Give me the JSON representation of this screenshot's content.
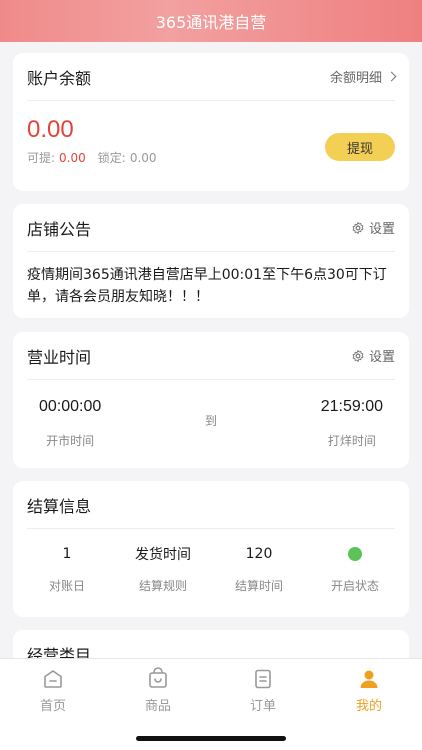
{
  "header": {
    "title": "365通讯港自营"
  },
  "balance": {
    "title": "账户余额",
    "detail_link": "余额明细",
    "amount": "0.00",
    "withdrawable_label": "可提:",
    "withdrawable_value": "0.00",
    "locked_label": "锁定:",
    "locked_value": "0.00",
    "withdraw_button": "提现"
  },
  "notice": {
    "title": "店铺公告",
    "settings_label": "设置",
    "text": "疫情期间365通讯港自营店早上00:01至下午6点30可下订单，请各会员朋友知晓！！！"
  },
  "hours": {
    "title": "营业时间",
    "settings_label": "设置",
    "open_time": "00:00:00",
    "open_label": "开市时间",
    "to_label": "到",
    "close_time": "21:59:00",
    "close_label": "打烊时间"
  },
  "settlement": {
    "title": "结算信息",
    "items": [
      {
        "value": "1",
        "label": "对账日"
      },
      {
        "value": "发货时间",
        "label": "结算规则"
      },
      {
        "value": "120",
        "label": "结算时间"
      },
      {
        "value": "",
        "label": "开启状态"
      }
    ],
    "status_color": "#5cc35a"
  },
  "category": {
    "title": "经营类目"
  },
  "tabs": [
    {
      "label": "首页",
      "icon": "home-icon"
    },
    {
      "label": "商品",
      "icon": "bag-icon"
    },
    {
      "label": "订单",
      "icon": "order-icon"
    },
    {
      "label": "我的",
      "icon": "profile-icon",
      "active": true
    }
  ],
  "colors": {
    "accent": "#f0a020",
    "amount_red": "#e0453a",
    "withdraw_yellow": "#f3cf54"
  }
}
